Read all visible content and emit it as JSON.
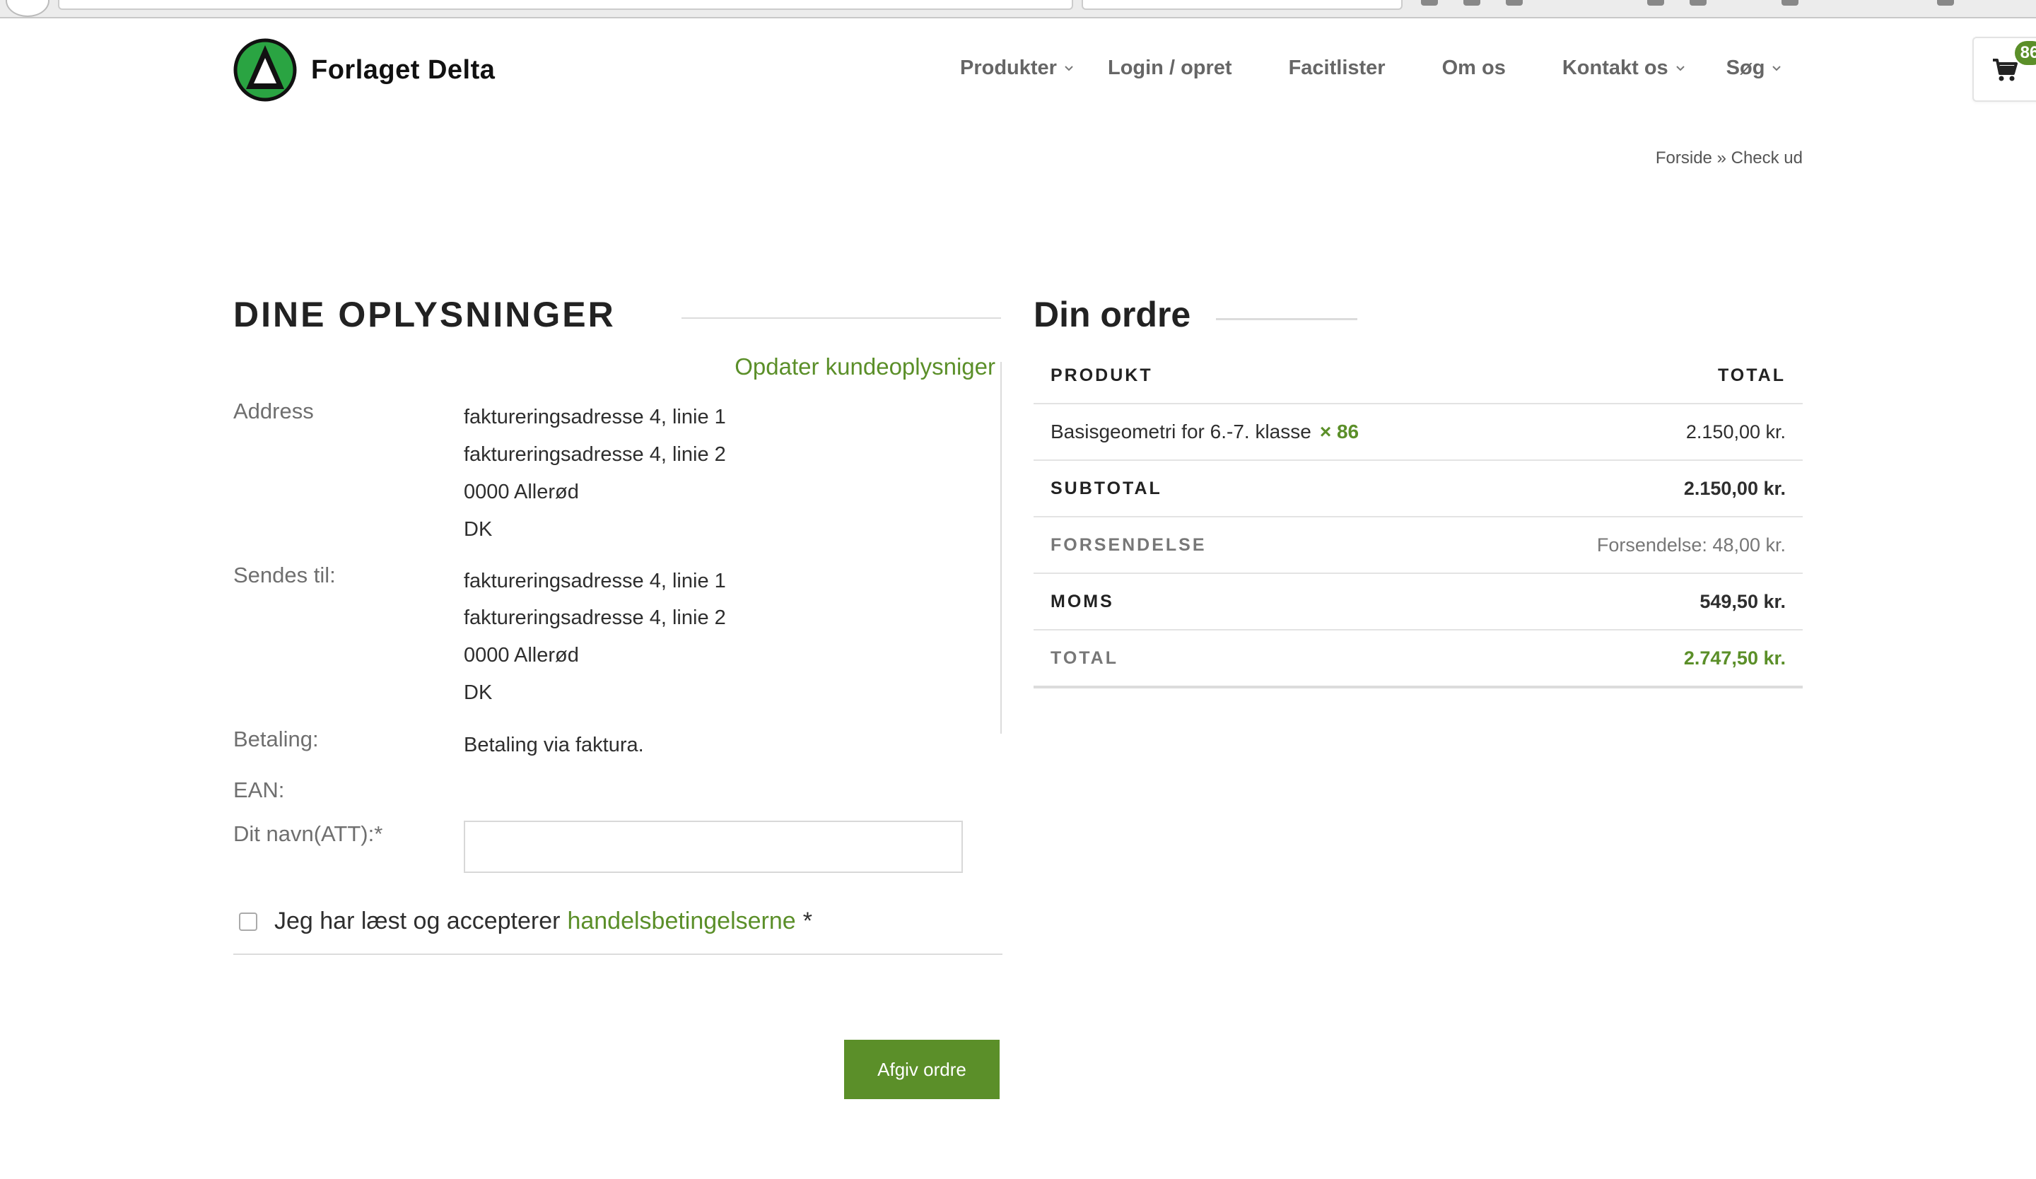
{
  "header": {
    "site_name": "Forlaget Delta",
    "nav": [
      {
        "label": "Produkter",
        "dropdown": true
      },
      {
        "label": "Login / opret",
        "dropdown": false
      },
      {
        "label": "Facitlister",
        "dropdown": false
      },
      {
        "label": "Om os",
        "dropdown": false
      },
      {
        "label": "Kontakt os",
        "dropdown": true
      },
      {
        "label": "Søg",
        "dropdown": true
      }
    ],
    "cart_count": "86"
  },
  "breadcrumb": {
    "home": "Forside",
    "separator": "»",
    "current": "Check ud"
  },
  "billing": {
    "title": "DINE OPLYSNINGER",
    "update_link": "Opdater kundeoplysniger",
    "address_label": "Address",
    "address_lines": [
      "faktureringsadresse 4, linie 1",
      "faktureringsadresse 4, linie 2",
      "0000 Allerød",
      "DK"
    ],
    "shipping_label": "Sendes til:",
    "shipping_lines": [
      "faktureringsadresse 4, linie 1",
      "faktureringsadresse 4, linie 2",
      "0000 Allerød",
      "DK"
    ],
    "payment_label": "Betaling:",
    "payment_value": "Betaling via faktura.",
    "ean_label": "EAN:",
    "name_label": "Dit navn(ATT):*",
    "name_value": "",
    "terms_text": "Jeg har læst og accepterer",
    "terms_link": "handelsbetingelserne",
    "terms_required": "*",
    "order_button": "Afgiv ordre"
  },
  "order": {
    "title": "Din ordre",
    "col_product": "PRODUKT",
    "col_total": "TOTAL",
    "item_name": "Basisgeometri for 6.-7. klasse",
    "item_qty": "× 86",
    "item_total": "2.150,00 kr.",
    "subtotal_label": "SUBTOTAL",
    "subtotal_value": "2.150,00 kr.",
    "shipping_label": "FORSENDELSE",
    "shipping_value": "Forsendelse: 48,00 kr.",
    "vat_label": "MOMS",
    "vat_value": "549,50 kr.",
    "total_label": "TOTAL",
    "total_value": "2.747,50 kr."
  },
  "colors": {
    "accent": "#5b8f29",
    "logo_green": "#2aa442"
  }
}
